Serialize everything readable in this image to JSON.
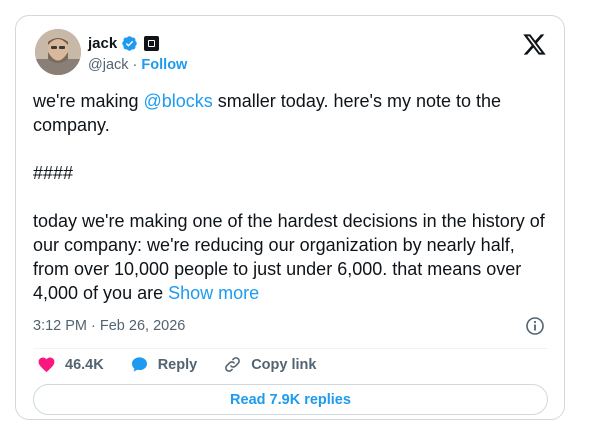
{
  "author": {
    "name": "jack",
    "handle": "@jack",
    "separator": "·",
    "follow_label": "Follow",
    "avatar_icon": "avatar",
    "verified_icon": "verified-badge-icon",
    "affiliate_icon": "block-square-icon"
  },
  "tweet": {
    "para1_pre": "we're making ",
    "para1_mention": "@blocks",
    "para1_post": " smaller today. here's my note to the company.",
    "para2": "####",
    "para3": "today we're making one of the hardest decisions in the history of our company: we're reducing our organization by nearly half, from over 10,000 people to just under 6,000. that means over 4,000 of you are ",
    "show_more": "Show more",
    "timestamp": "3:12 PM · Feb 26, 2026"
  },
  "actions": {
    "likes": "46.4K",
    "reply_label": "Reply",
    "copy_link_label": "Copy link"
  },
  "read_replies_label": "Read 7.9K replies",
  "colors": {
    "accent": "#1d9bf0",
    "like": "#f91880",
    "text": "#0f1419",
    "muted": "#536471",
    "border": "#cfd9de"
  }
}
